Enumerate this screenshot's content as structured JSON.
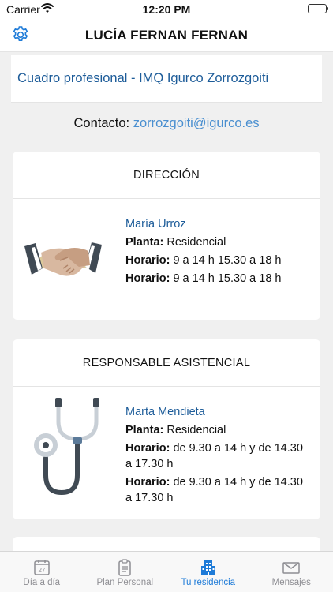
{
  "status_bar": {
    "carrier": "Carrier",
    "time": "12:20 PM"
  },
  "nav": {
    "title": "LUCÍA FERNAN FERNAN"
  },
  "center": {
    "label": "Cuadro profesional - IMQ Igurco Zorrozgoiti"
  },
  "contact": {
    "label": "Contacto:",
    "email": "zorrozgoiti@igurco.es"
  },
  "cards": [
    {
      "header": "DIRECCIÓN",
      "icon": "handshake-icon",
      "name": "María Urroz",
      "planta_label": "Planta:",
      "planta_value": "Residencial",
      "horarios": [
        {
          "label": "Horario:",
          "value": "9 a 14 h 15.30 a 18 h"
        },
        {
          "label": "Horario:",
          "value": "9 a 14 h 15.30 a 18 h"
        }
      ]
    },
    {
      "header": "RESPONSABLE ASISTENCIAL",
      "icon": "stethoscope-icon",
      "name": "Marta Mendieta",
      "planta_label": "Planta:",
      "planta_value": "Residencial",
      "horarios": [
        {
          "label": "Horario:",
          "value": "de 9.30 a 14 h y de 14.30 a 17.30 h"
        },
        {
          "label": "Horario:",
          "value": "de 9.30 a 14 h y de 14.30 a 17.30 h"
        }
      ]
    }
  ],
  "tabs": [
    {
      "label": "Día a día",
      "icon": "calendar-icon",
      "badge": "27",
      "active": false
    },
    {
      "label": "Plan Personal",
      "icon": "clipboard-icon",
      "active": false
    },
    {
      "label": "Tu residencia",
      "icon": "building-icon",
      "active": true
    },
    {
      "label": "Mensajes",
      "icon": "envelope-icon",
      "active": false
    }
  ],
  "colors": {
    "accent": "#1e7bd8",
    "link": "#1d5c99",
    "email": "#4a8fd0",
    "background": "#f0f0f0"
  }
}
